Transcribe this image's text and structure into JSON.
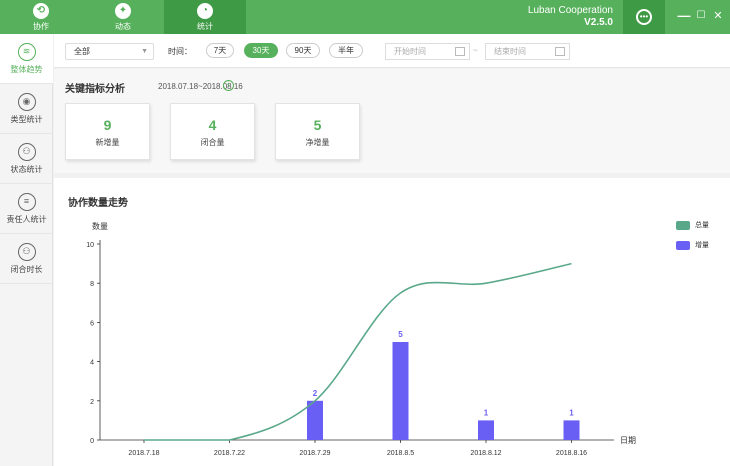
{
  "nav": {
    "tabs": [
      {
        "label": "协作",
        "icon": "collab-icon"
      },
      {
        "label": "动态",
        "icon": "activity-icon"
      },
      {
        "label": "统计",
        "icon": "stats-icon"
      }
    ],
    "active_tab": "统计"
  },
  "brand": {
    "name": "Luban Cooperation",
    "version": "V2.5.0"
  },
  "window_controls": {
    "minimize": "—",
    "maximize": "☐",
    "close": "✕"
  },
  "sidebar": {
    "items": [
      {
        "label": "整体趋势",
        "icon": "trend-icon"
      },
      {
        "label": "类型统计",
        "icon": "type-icon"
      },
      {
        "label": "状态统计",
        "icon": "status-icon"
      },
      {
        "label": "责任人统计",
        "icon": "person-icon"
      },
      {
        "label": "闭合时长",
        "icon": "clock-icon"
      }
    ],
    "active": "整体趋势"
  },
  "filter": {
    "select_value": "全部",
    "time_label": "时间：",
    "ranges": [
      "7天",
      "30天",
      "90天",
      "半年"
    ],
    "active_range": "30天",
    "start_placeholder": "开始时间",
    "end_placeholder": "结束时间",
    "separator": "~"
  },
  "kpi": {
    "title": "关键指标分析",
    "range": "2018.07.18~2018.08.16",
    "cards": [
      {
        "value": "9",
        "label": "新增量"
      },
      {
        "value": "4",
        "label": "闭合量"
      },
      {
        "value": "5",
        "label": "净增量"
      }
    ]
  },
  "colors": {
    "brand": "#57b15c",
    "line": "#5aa88a",
    "bar": "#6a5ff5"
  },
  "chart_data": {
    "type": "bar+line",
    "title": "协作数量走势",
    "ylabel": "数量",
    "xlabel": "日期",
    "ylim": [
      0,
      10
    ],
    "yticks": [
      0,
      2,
      4,
      6,
      8,
      10
    ],
    "xticks": [
      "2018.7.18",
      "2018.7.22",
      "2018.7.29",
      "2018.8.5",
      "2018.8.12",
      "2018.8.16"
    ],
    "series": [
      {
        "name": "总量",
        "type": "line",
        "x": [
          "2018.7.18",
          "2018.7.22",
          "2018.7.29",
          "2018.8.5",
          "2018.8.12",
          "2018.8.16"
        ],
        "values": [
          0,
          0,
          2,
          7.5,
          8,
          9
        ]
      },
      {
        "name": "增量",
        "type": "bar",
        "x": [
          "2018.7.29",
          "2018.8.5",
          "2018.8.12",
          "2018.8.16"
        ],
        "values": [
          2,
          5,
          1,
          1
        ]
      }
    ]
  }
}
